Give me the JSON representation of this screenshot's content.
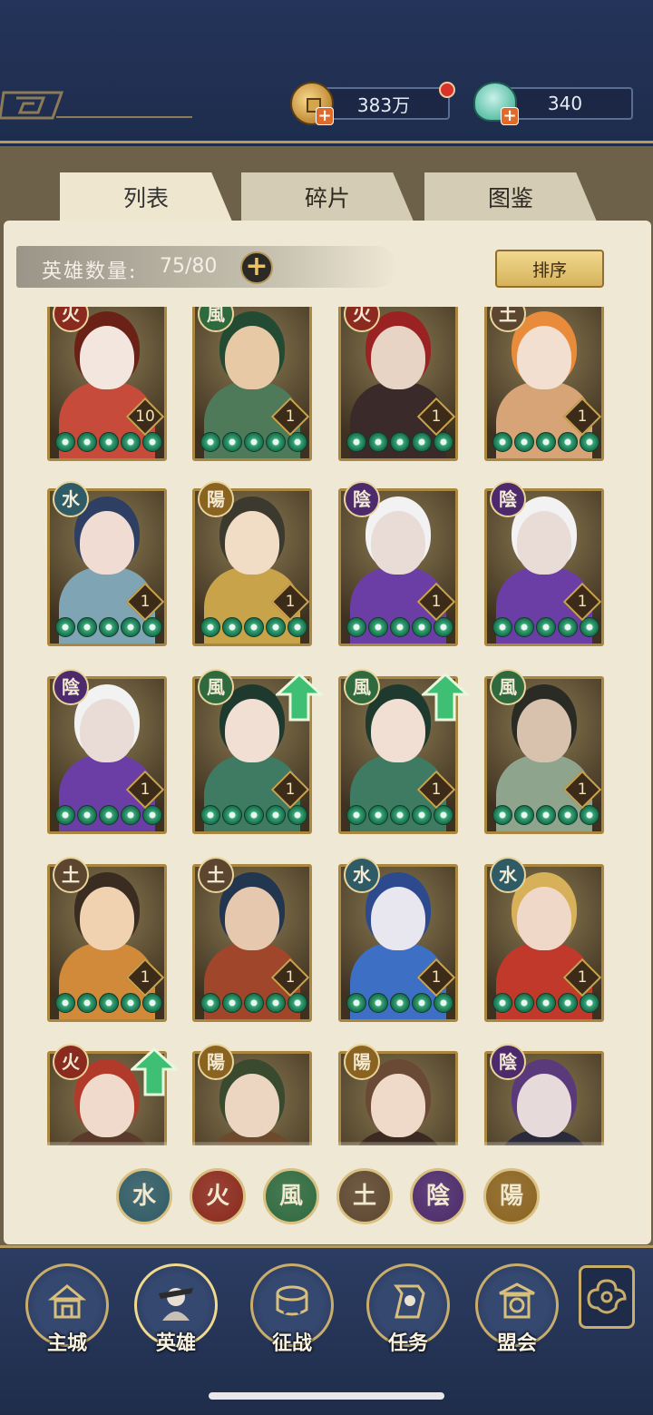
{
  "top": {
    "gold": "383万",
    "jade": "340",
    "plus": "+"
  },
  "tabs": [
    {
      "label": "列表",
      "active": true
    },
    {
      "label": "碎片",
      "active": false
    },
    {
      "label": "图鉴",
      "active": false
    }
  ],
  "hero_count": {
    "label": "英雄数量:",
    "value": "75/80",
    "add": "+"
  },
  "sort_label": "排序",
  "heroes": [
    {
      "element": "火",
      "element_color": "#8b2a1e",
      "level": "10",
      "palette": [
        "#c64b3a",
        "#f2e6de",
        "#6a2217"
      ],
      "upgrade": false
    },
    {
      "element": "風",
      "element_color": "#2f6a3f",
      "level": "1",
      "palette": [
        "#4f7a5a",
        "#e8c9a6",
        "#234b33"
      ],
      "upgrade": false
    },
    {
      "element": "火",
      "element_color": "#8b2a1e",
      "level": "1",
      "palette": [
        "#3a2a2a",
        "#e7d4c4",
        "#9a2222"
      ],
      "upgrade": false
    },
    {
      "element": "土",
      "element_color": "#5d4630",
      "level": "1",
      "palette": [
        "#d6a476",
        "#f2dfcf",
        "#e88b3a"
      ],
      "upgrade": false
    },
    {
      "element": "水",
      "element_color": "#2f5b66",
      "level": "1",
      "palette": [
        "#7fa4b3",
        "#f0dcd3",
        "#2e3f63"
      ],
      "upgrade": false
    },
    {
      "element": "陽",
      "element_color": "#8a6320",
      "level": "1",
      "palette": [
        "#c8a34a",
        "#f1dcc6",
        "#3c3a2f"
      ],
      "upgrade": false
    },
    {
      "element": "陰",
      "element_color": "#4c2a6b",
      "level": "1",
      "palette": [
        "#6b3ea6",
        "#e9dcd6",
        "#f2f2f2"
      ],
      "upgrade": false
    },
    {
      "element": "陰",
      "element_color": "#4c2a6b",
      "level": "1",
      "palette": [
        "#6b3ea6",
        "#e9dcd6",
        "#f2f2f2"
      ],
      "upgrade": false
    },
    {
      "element": "陰",
      "element_color": "#4c2a6b",
      "level": "1",
      "palette": [
        "#6b3ea6",
        "#e9dcd6",
        "#f2f2f2"
      ],
      "upgrade": false
    },
    {
      "element": "風",
      "element_color": "#2f6a3f",
      "level": "1",
      "palette": [
        "#3f7a62",
        "#f0dfd2",
        "#1e3a2e"
      ],
      "upgrade": true
    },
    {
      "element": "風",
      "element_color": "#2f6a3f",
      "level": "1",
      "palette": [
        "#3f7a62",
        "#f0dfd2",
        "#1e3a2e"
      ],
      "upgrade": true
    },
    {
      "element": "風",
      "element_color": "#2f6a3f",
      "level": "1",
      "palette": [
        "#8fa48c",
        "#d8c2ae",
        "#2b2b26"
      ],
      "upgrade": false
    },
    {
      "element": "土",
      "element_color": "#5d4630",
      "level": "1",
      "palette": [
        "#d08a3a",
        "#f0d2b0",
        "#3a2c20"
      ],
      "upgrade": false
    },
    {
      "element": "土",
      "element_color": "#5d4630",
      "level": "1",
      "palette": [
        "#a0462a",
        "#e6c8ae",
        "#23364f"
      ],
      "upgrade": false
    },
    {
      "element": "水",
      "element_color": "#2f5b66",
      "level": "1",
      "palette": [
        "#3d6fc4",
        "#e8e6ee",
        "#2d4a8f"
      ],
      "upgrade": false
    },
    {
      "element": "水",
      "element_color": "#2f5b66",
      "level": "1",
      "palette": [
        "#c0392b",
        "#f0d8c8",
        "#d7b15a"
      ],
      "upgrade": false
    },
    {
      "element": "火",
      "element_color": "#8b2a1e",
      "level": "",
      "palette": [
        "#5a3a2a",
        "#f0dacb",
        "#b23a2a"
      ],
      "upgrade": true
    },
    {
      "element": "陽",
      "element_color": "#8a6320",
      "level": "",
      "palette": [
        "#6b4a2e",
        "#ecd6c2",
        "#3a4a2e"
      ],
      "upgrade": false
    },
    {
      "element": "陽",
      "element_color": "#8a6320",
      "level": "",
      "palette": [
        "#3a2a22",
        "#efd9c8",
        "#6a4a34"
      ],
      "upgrade": false
    },
    {
      "element": "陰",
      "element_color": "#4c2a6b",
      "level": "",
      "palette": [
        "#2a2a3a",
        "#e6dada",
        "#5a3a7a"
      ],
      "upgrade": false
    }
  ],
  "filters": [
    {
      "label": "水",
      "color": "#2f5b66"
    },
    {
      "label": "火",
      "color": "#8b2a1e"
    },
    {
      "label": "風",
      "color": "#2f6a3f"
    },
    {
      "label": "土",
      "color": "#5d4630"
    },
    {
      "label": "陰",
      "color": "#4c2a6b"
    },
    {
      "label": "陽",
      "color": "#8a6320"
    }
  ],
  "nav": [
    {
      "label": "主城",
      "icon": "city-gate-icon"
    },
    {
      "label": "英雄",
      "icon": "hero-portrait-icon",
      "active": true
    },
    {
      "label": "征战",
      "icon": "battle-drum-icon"
    },
    {
      "label": "任务",
      "icon": "scroll-task-icon"
    },
    {
      "label": "盟会",
      "icon": "alliance-hall-icon"
    }
  ]
}
